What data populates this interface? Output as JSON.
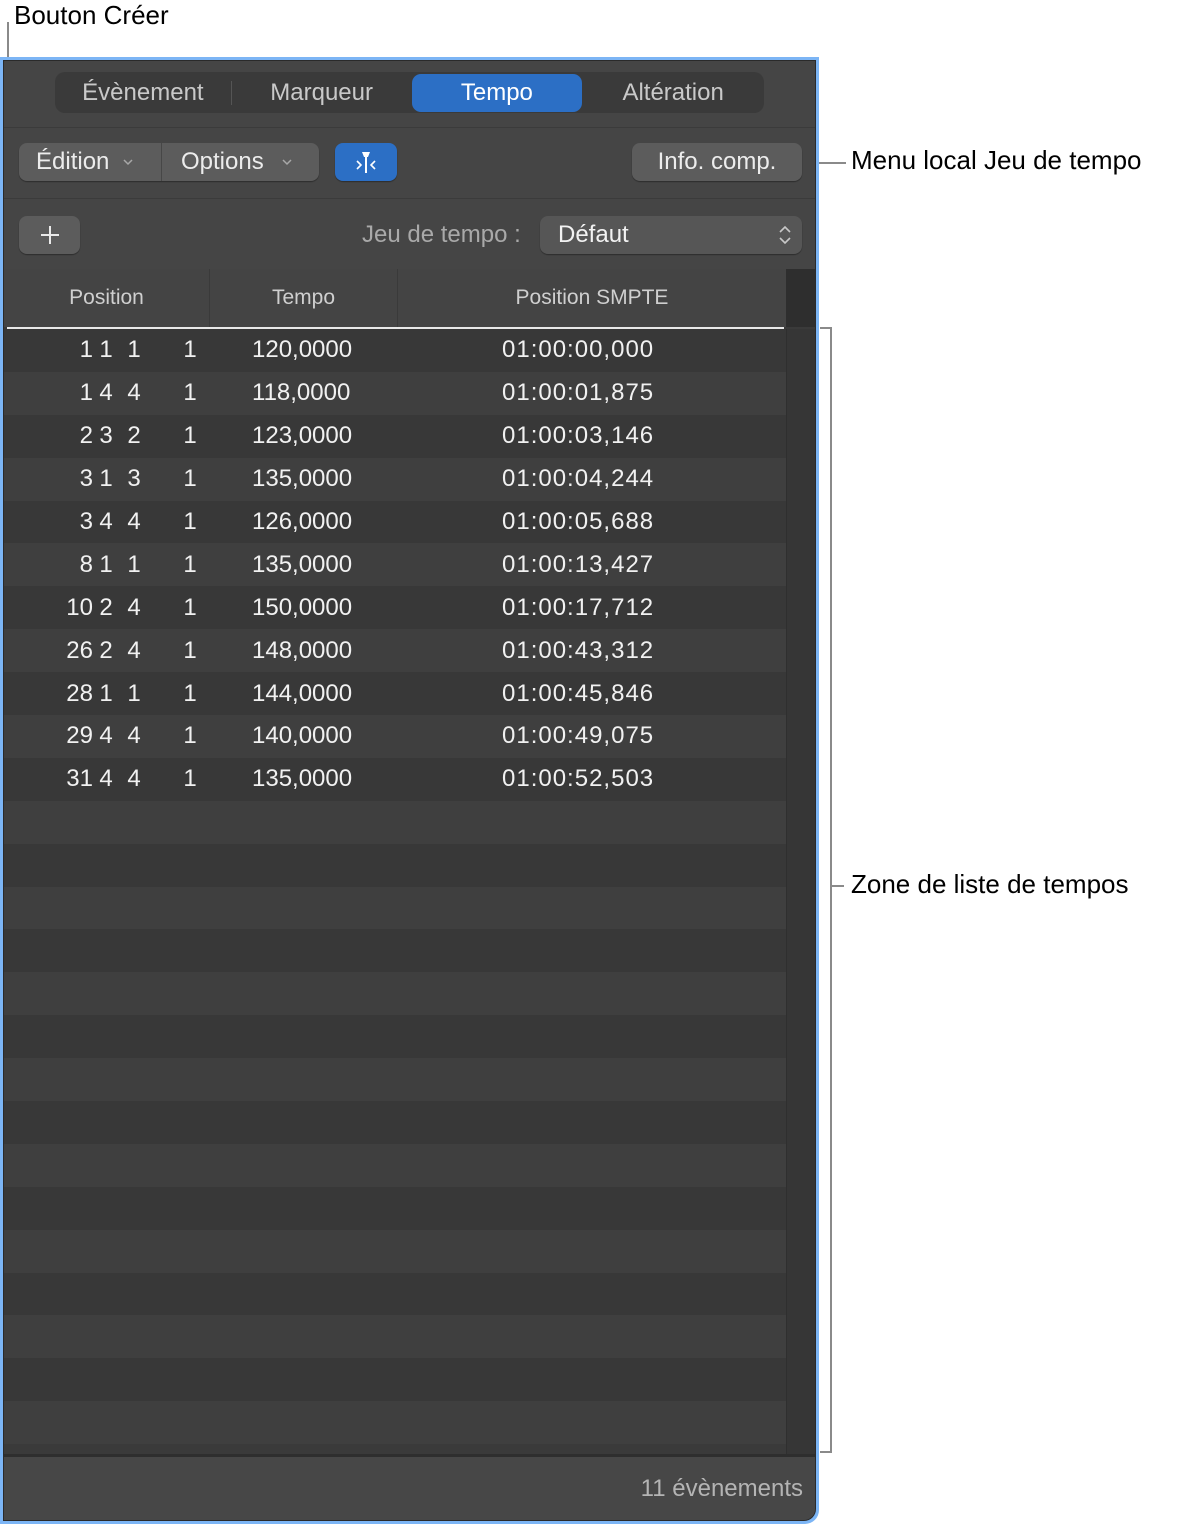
{
  "callouts": {
    "create_button": "Bouton Créer",
    "tempo_set_menu": "Menu local Jeu de tempo",
    "tempo_list_area": "Zone de liste de tempos"
  },
  "tabs": [
    {
      "label": "Évènement",
      "selected": false
    },
    {
      "label": "Marqueur",
      "selected": false
    },
    {
      "label": "Tempo",
      "selected": true
    },
    {
      "label": "Altération",
      "selected": false
    }
  ],
  "toolbar": {
    "edit_menu": "Édition",
    "options_menu": "Options",
    "catch_button_icon": "catch-playhead-icon",
    "info_button": "Info. comp.",
    "create_button_icon": "plus-icon",
    "tempo_set_label": "Jeu de tempo :",
    "tempo_set_value": "Défaut"
  },
  "colors": {
    "accent": "#2c6fc5",
    "panel_bg": "#454545",
    "window_highlight": "#7cb5f5"
  },
  "table": {
    "columns": [
      "Position",
      "Tempo",
      "Position SMPTE"
    ],
    "rows": [
      {
        "bar": "1",
        "beat": "1",
        "div": "1",
        "tick": "1",
        "tempo": "120,0000",
        "smpte": "01:00:00,000"
      },
      {
        "bar": "1",
        "beat": "4",
        "div": "4",
        "tick": "1",
        "tempo": "118,0000",
        "smpte": "01:00:01,875"
      },
      {
        "bar": "2",
        "beat": "3",
        "div": "2",
        "tick": "1",
        "tempo": "123,0000",
        "smpte": "01:00:03,146"
      },
      {
        "bar": "3",
        "beat": "1",
        "div": "3",
        "tick": "1",
        "tempo": "135,0000",
        "smpte": "01:00:04,244"
      },
      {
        "bar": "3",
        "beat": "4",
        "div": "4",
        "tick": "1",
        "tempo": "126,0000",
        "smpte": "01:00:05,688"
      },
      {
        "bar": "8",
        "beat": "1",
        "div": "1",
        "tick": "1",
        "tempo": "135,0000",
        "smpte": "01:00:13,427"
      },
      {
        "bar": "10",
        "beat": "2",
        "div": "4",
        "tick": "1",
        "tempo": "150,0000",
        "smpte": "01:00:17,712"
      },
      {
        "bar": "26",
        "beat": "2",
        "div": "4",
        "tick": "1",
        "tempo": "148,0000",
        "smpte": "01:00:43,312"
      },
      {
        "bar": "28",
        "beat": "1",
        "div": "1",
        "tick": "1",
        "tempo": "144,0000",
        "smpte": "01:00:45,846"
      },
      {
        "bar": "29",
        "beat": "4",
        "div": "4",
        "tick": "1",
        "tempo": "140,0000",
        "smpte": "01:00:49,075"
      },
      {
        "bar": "31",
        "beat": "4",
        "div": "4",
        "tick": "1",
        "tempo": "135,0000",
        "smpte": "01:00:52,503"
      }
    ]
  },
  "footer": {
    "event_count": "11 évènements"
  }
}
